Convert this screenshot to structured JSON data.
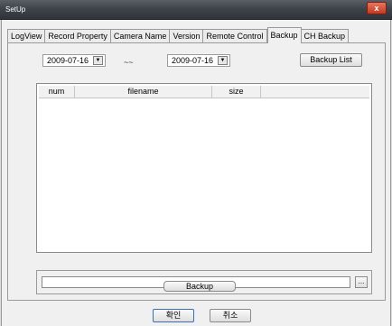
{
  "window": {
    "title": "SetUp",
    "close_label": "x"
  },
  "tabs": [
    {
      "label": "LogView"
    },
    {
      "label": "Record Property"
    },
    {
      "label": "Camera Name"
    },
    {
      "label": "Version"
    },
    {
      "label": "Remote Control"
    },
    {
      "label": "Backup",
      "active": true
    },
    {
      "label": "CH Backup"
    }
  ],
  "backup": {
    "start_date": "2009-07-16",
    "separator": "~~",
    "end_date": "2009-07-16",
    "backup_list_label": "Backup List",
    "list_columns": [
      "num",
      "filename",
      "size"
    ],
    "browse_label": "...",
    "path_value": "",
    "backup_label": "Backup"
  },
  "footer": {
    "ok_label": "확인",
    "cancel_label": "취소"
  }
}
